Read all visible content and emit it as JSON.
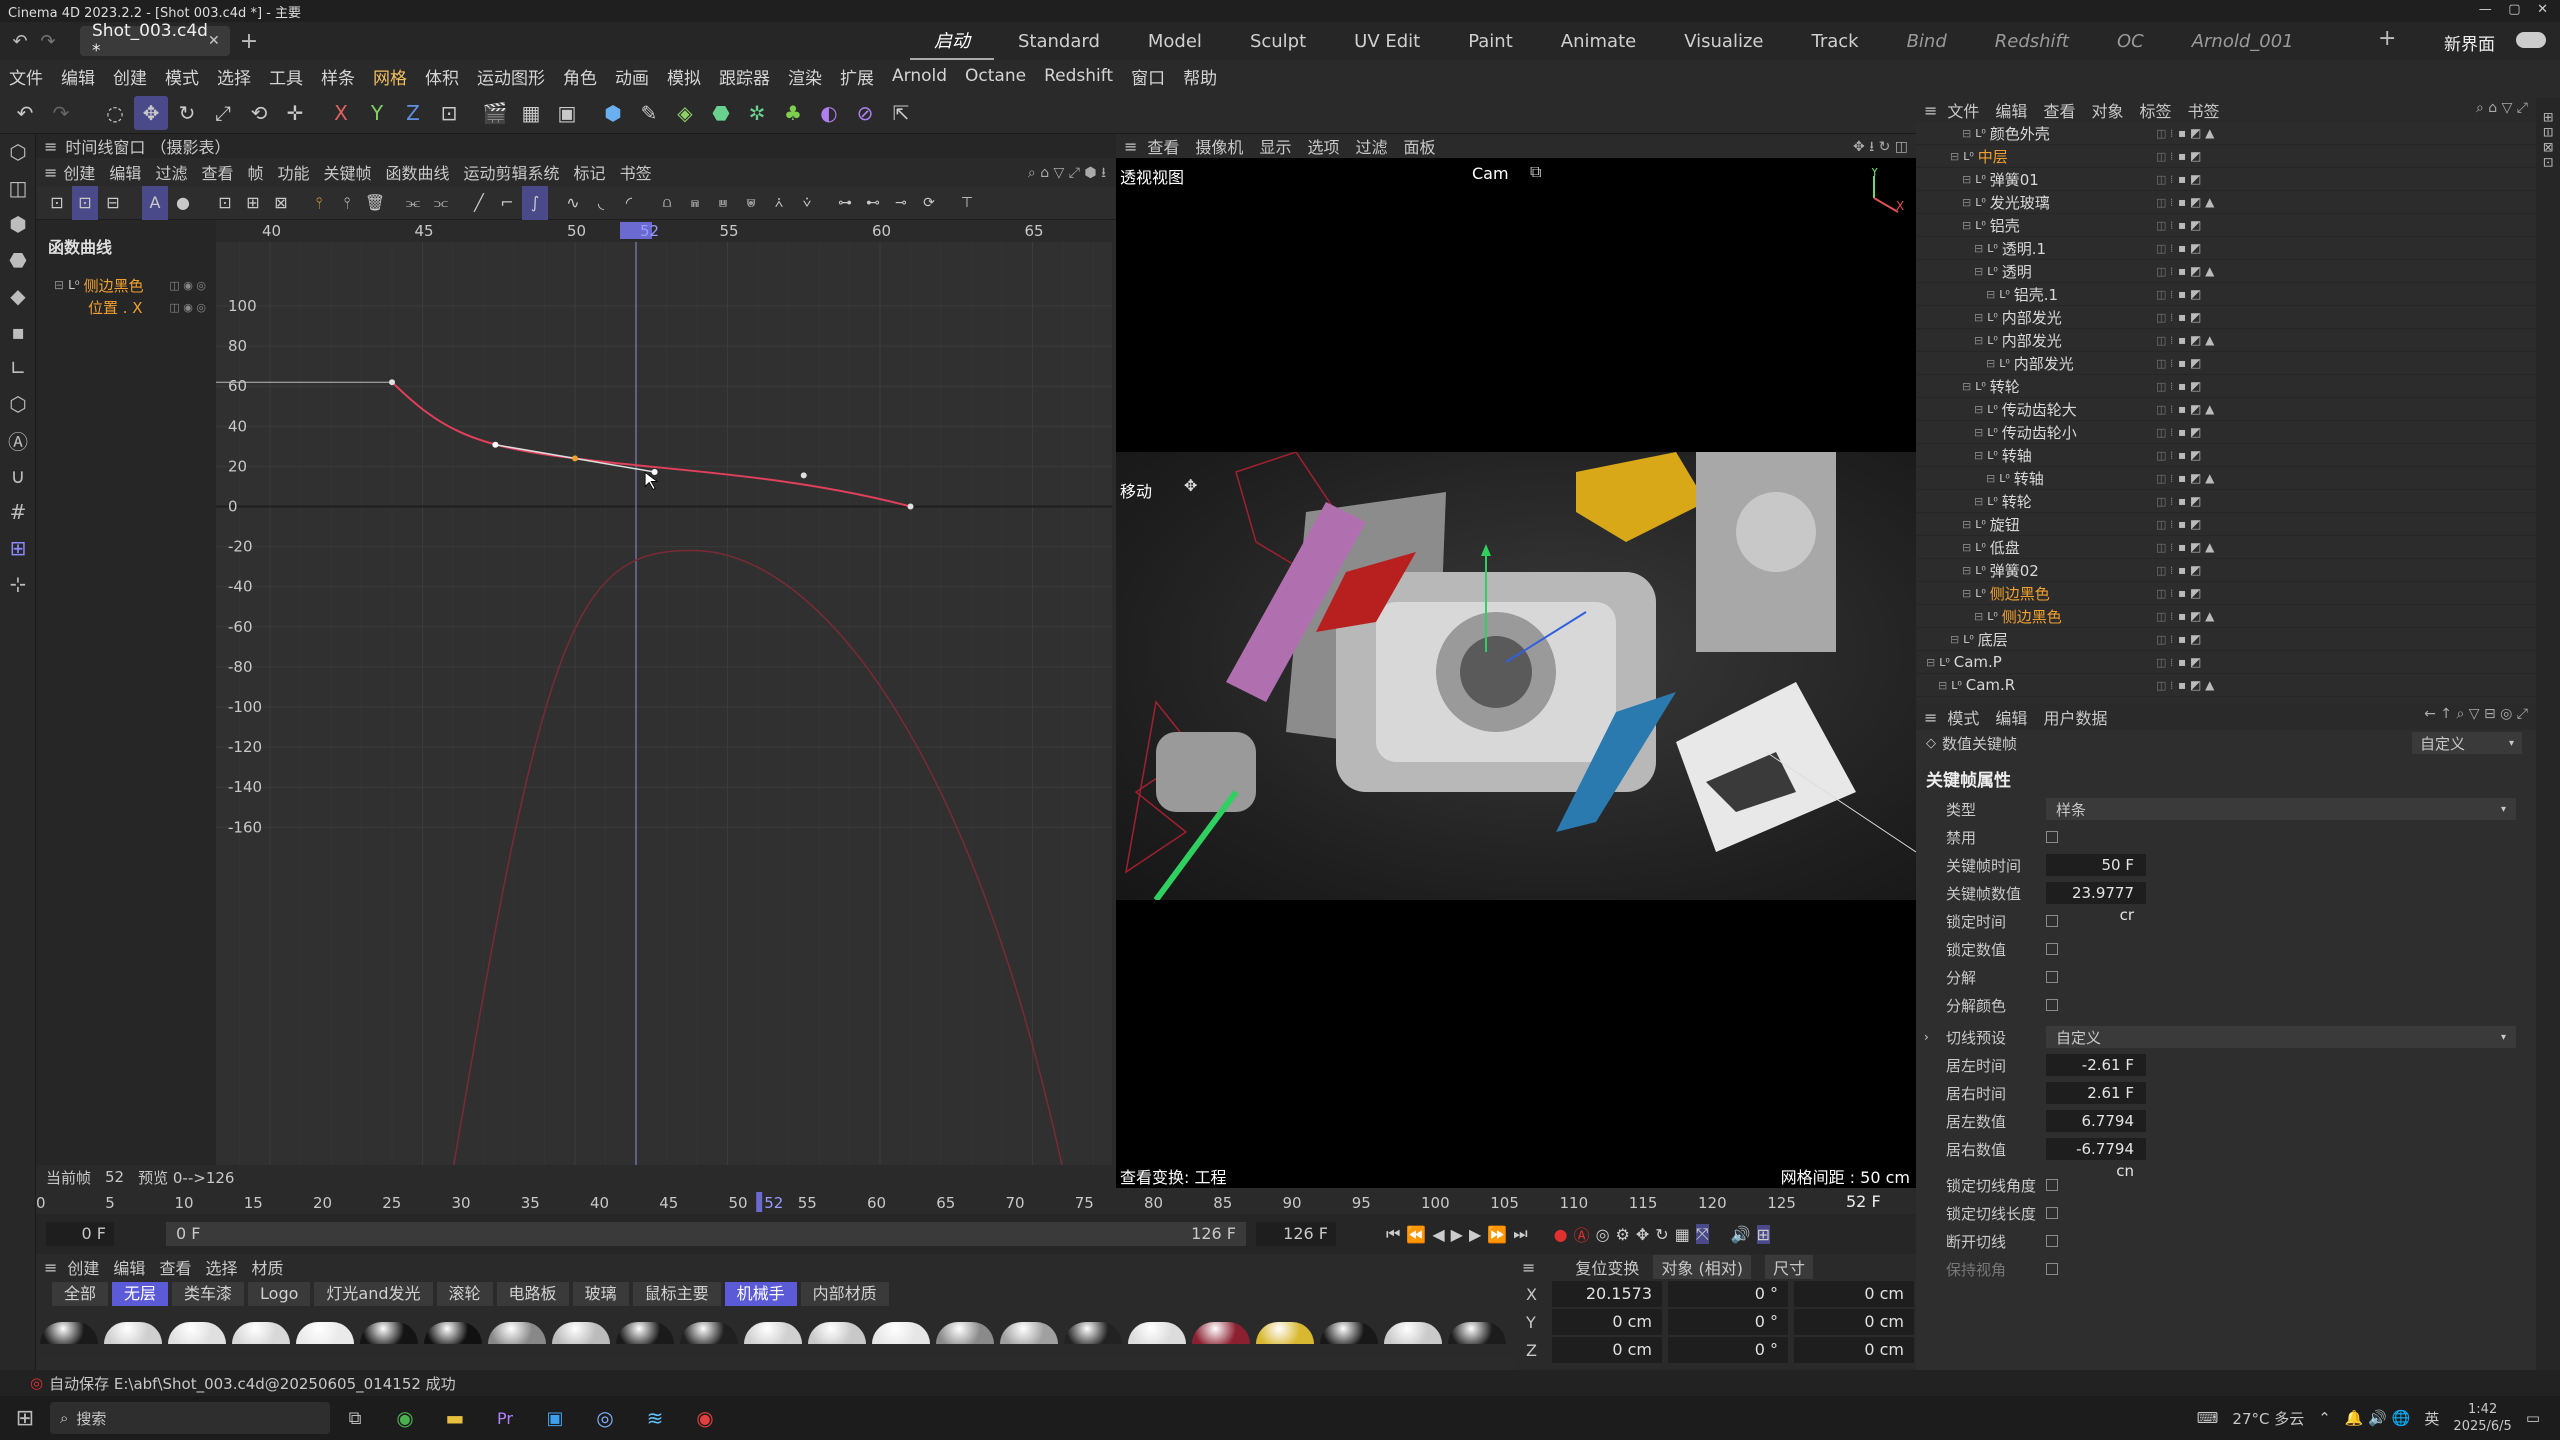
{
  "titlebar": {
    "title": "Cinema 4D 2023.2.2 - [Shot 003.c4d *] - 主要"
  },
  "tabbar": {
    "doc_tab": "Shot_003.c4d *",
    "layouts": [
      "启动",
      "Standard",
      "Model",
      "Sculpt",
      "UV Edit",
      "Paint",
      "Animate",
      "Visualize",
      "Track",
      "Bind",
      "Redshift",
      "OC",
      "Arnold_001"
    ],
    "new_layout": "新界面"
  },
  "menubar": [
    "文件",
    "编辑",
    "创建",
    "模式",
    "选择",
    "工具",
    "样条",
    "网格",
    "体积",
    "运动图形",
    "角色",
    "动画",
    "模拟",
    "跟踪器",
    "渲染",
    "扩展",
    "Arnold",
    "Octane",
    "Redshift",
    "窗口",
    "帮助"
  ],
  "timeline": {
    "title": "时间线窗口 （摄影表）",
    "menu": [
      "创建",
      "编辑",
      "过滤",
      "查看",
      "帧",
      "功能",
      "关键帧",
      "函数曲线",
      "运动剪辑系统",
      "标记",
      "书签"
    ],
    "tree_header": "函数曲线",
    "tree": [
      {
        "label": "侧边黑色"
      },
      {
        "label": "位置 . X"
      }
    ],
    "ruler": [
      "40",
      "45",
      "50",
      "52",
      "55",
      "60",
      "65"
    ],
    "y_labels": [
      "100",
      "80",
      "60",
      "40",
      "20",
      "0",
      "-20",
      "-40",
      "-60",
      "-80",
      "-100",
      "-120",
      "-140",
      "-160"
    ],
    "status_current": "当前帧",
    "status_frame": "52",
    "status_preview": "预览  0-->126",
    "curve_color": "#e0405a"
  },
  "viewport": {
    "menu": [
      "查看",
      "摄像机",
      "显示",
      "选项",
      "过滤",
      "面板"
    ],
    "name": "透视视图",
    "camera": "Cam",
    "move_label": "移动",
    "transform_label": "查看变换: 工程",
    "grid_label": "网格间距 : 50 cm"
  },
  "objman": {
    "menu": [
      "文件",
      "编辑",
      "查看",
      "对象",
      "标签",
      "书签"
    ],
    "rows": [
      {
        "label": "颜色外壳",
        "indent": 3
      },
      {
        "label": "中层",
        "indent": 2,
        "sel": true
      },
      {
        "label": "弹簧01",
        "indent": 3
      },
      {
        "label": "发光玻璃",
        "indent": 3
      },
      {
        "label": "铝壳",
        "indent": 3
      },
      {
        "label": "透明.1",
        "indent": 4
      },
      {
        "label": "透明",
        "indent": 4
      },
      {
        "label": "铝壳.1",
        "indent": 5
      },
      {
        "label": "内部发光",
        "indent": 4
      },
      {
        "label": "内部发光",
        "indent": 4
      },
      {
        "label": "内部发光",
        "indent": 5
      },
      {
        "label": "转轮",
        "indent": 3
      },
      {
        "label": "传动齿轮大",
        "indent": 4
      },
      {
        "label": "传动齿轮小",
        "indent": 4
      },
      {
        "label": "转轴",
        "indent": 4
      },
      {
        "label": "转轴",
        "indent": 5
      },
      {
        "label": "转轮",
        "indent": 4
      },
      {
        "label": "旋钮",
        "indent": 3
      },
      {
        "label": "低盘",
        "indent": 3
      },
      {
        "label": "弹簧02",
        "indent": 3
      },
      {
        "label": "侧边黑色",
        "indent": 3,
        "sel": true
      },
      {
        "label": "侧边黑色",
        "indent": 4,
        "sel": true
      },
      {
        "label": "底层",
        "indent": 2
      },
      {
        "label": "Cam.P",
        "indent": 0
      },
      {
        "label": "Cam.R",
        "indent": 1
      }
    ]
  },
  "attr": {
    "menu": [
      "模式",
      "编辑",
      "用户数据"
    ],
    "subtitle": "数值关键帧",
    "preset": "自定义",
    "section": "关键帧属性",
    "type_label": "类型",
    "type_value": "样条",
    "fields": [
      {
        "label": "禁用",
        "kind": "chk"
      },
      {
        "label": "关键帧时间",
        "value": "50 F"
      },
      {
        "label": "关键帧数值",
        "value": "23.9777 cr"
      },
      {
        "label": "锁定时间",
        "kind": "chk"
      },
      {
        "label": "锁定数值",
        "kind": "chk"
      },
      {
        "label": "分解",
        "kind": "chk"
      },
      {
        "label": "分解颜色",
        "kind": "chk"
      }
    ],
    "tangent_label": "切线预设",
    "tangent_value": "自定义",
    "tangent_fields": [
      {
        "label": "居左时间",
        "value": "-2.61 F"
      },
      {
        "label": "居右时间",
        "value": "2.61 F"
      },
      {
        "label": "居左数值",
        "value": "6.7794 cm"
      },
      {
        "label": "居右数值",
        "value": "-6.7794 cn"
      }
    ],
    "lock_fields": [
      "锁定切线角度",
      "锁定切线长度",
      "断开切线",
      "保持视角"
    ]
  },
  "framebar": {
    "ticks": [
      "0",
      "5",
      "10",
      "15",
      "20",
      "25",
      "30",
      "35",
      "40",
      "45",
      "50",
      "52",
      "55",
      "60",
      "65",
      "70",
      "75",
      "80",
      "85",
      "90",
      "95",
      "100",
      "105",
      "110",
      "115",
      "120",
      "125"
    ],
    "end": "52 F"
  },
  "transport": {
    "start": "0 F",
    "min": "0 F",
    "max": "126 F",
    "end": "126 F"
  },
  "materials": {
    "menu": [
      "创建",
      "编辑",
      "查看",
      "选择",
      "材质"
    ],
    "tabs": [
      "全部",
      "无层",
      "类车漆",
      "Logo",
      "灯光and发光",
      "滚轮",
      "电路板",
      "玻璃",
      "鼠标主要",
      "机械手",
      "内部材质"
    ],
    "active": [
      1,
      9
    ]
  },
  "coords": {
    "head": [
      "复位变换",
      "对象 (相对)",
      "尺寸"
    ],
    "rows": [
      {
        "axis": "X",
        "pos": "20.1573 cm",
        "rot": "0 °",
        "size": "0 cm"
      },
      {
        "axis": "Y",
        "pos": "0 cm",
        "rot": "0 °",
        "size": "0 cm"
      },
      {
        "axis": "Z",
        "pos": "0 cm",
        "rot": "0 °",
        "size": "0 cm"
      }
    ]
  },
  "status": {
    "text": "自动保存 E:\\abf\\Shot_003.c4d@20250605_014152 成功"
  },
  "taskbar": {
    "search": "搜索",
    "weather": "27°C 多云",
    "ime": "英",
    "time": "1:42",
    "date": "2025/6/5"
  }
}
